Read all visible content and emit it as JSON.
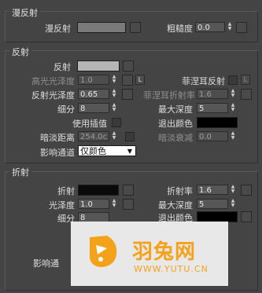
{
  "diffuse_panel": {
    "title": "漫反射",
    "diffuse_label": "漫反射",
    "diffuse_color": "#7a7a7a",
    "roughness_label": "粗糙度",
    "roughness_value": "0.0"
  },
  "reflect_panel": {
    "title": "反射",
    "reflect_label": "反射",
    "reflect_color": "#b5b5b5",
    "hilight_gloss_label": "高光光泽度",
    "hilight_gloss_value": "1.0",
    "lock_label": "L",
    "fresnel_label": "菲涅耳反射",
    "refl_gloss_label": "反射光泽度",
    "refl_gloss_value": "0.65",
    "fresnel_ior_label": "菲涅耳折射率",
    "fresnel_ior_value": "1.6",
    "subdivs_label": "细分",
    "subdivs_value": "8",
    "max_depth_label": "最大深度",
    "max_depth_value": "5",
    "use_interp_label": "使用插值",
    "exit_color_label": "退出颜色",
    "exit_color": "#000000",
    "dim_distance_label": "暗淡距离",
    "dim_distance_value": "254.0c",
    "dim_falloff_label": "暗淡衰减",
    "dim_falloff_value": "0.0",
    "affect_channels_label": "影响通道",
    "affect_channels_value": "仅颜色"
  },
  "refract_panel": {
    "title": "折射",
    "refract_label": "折射",
    "refract_color": "#0a0a0a",
    "ior_label": "折射率",
    "ior_value": "1.6",
    "gloss_label": "光泽度",
    "gloss_value": "1.0",
    "max_depth_label": "最大深度",
    "max_depth_value": "5",
    "subdivs_label": "细分",
    "subdivs_value": "8",
    "exit_color_label": "退出颜色",
    "affect_label": "影响通"
  },
  "watermark": {
    "brand": "羽兔网",
    "url": "WWW.YUTU.CN",
    "accent": "#f5a21b"
  }
}
